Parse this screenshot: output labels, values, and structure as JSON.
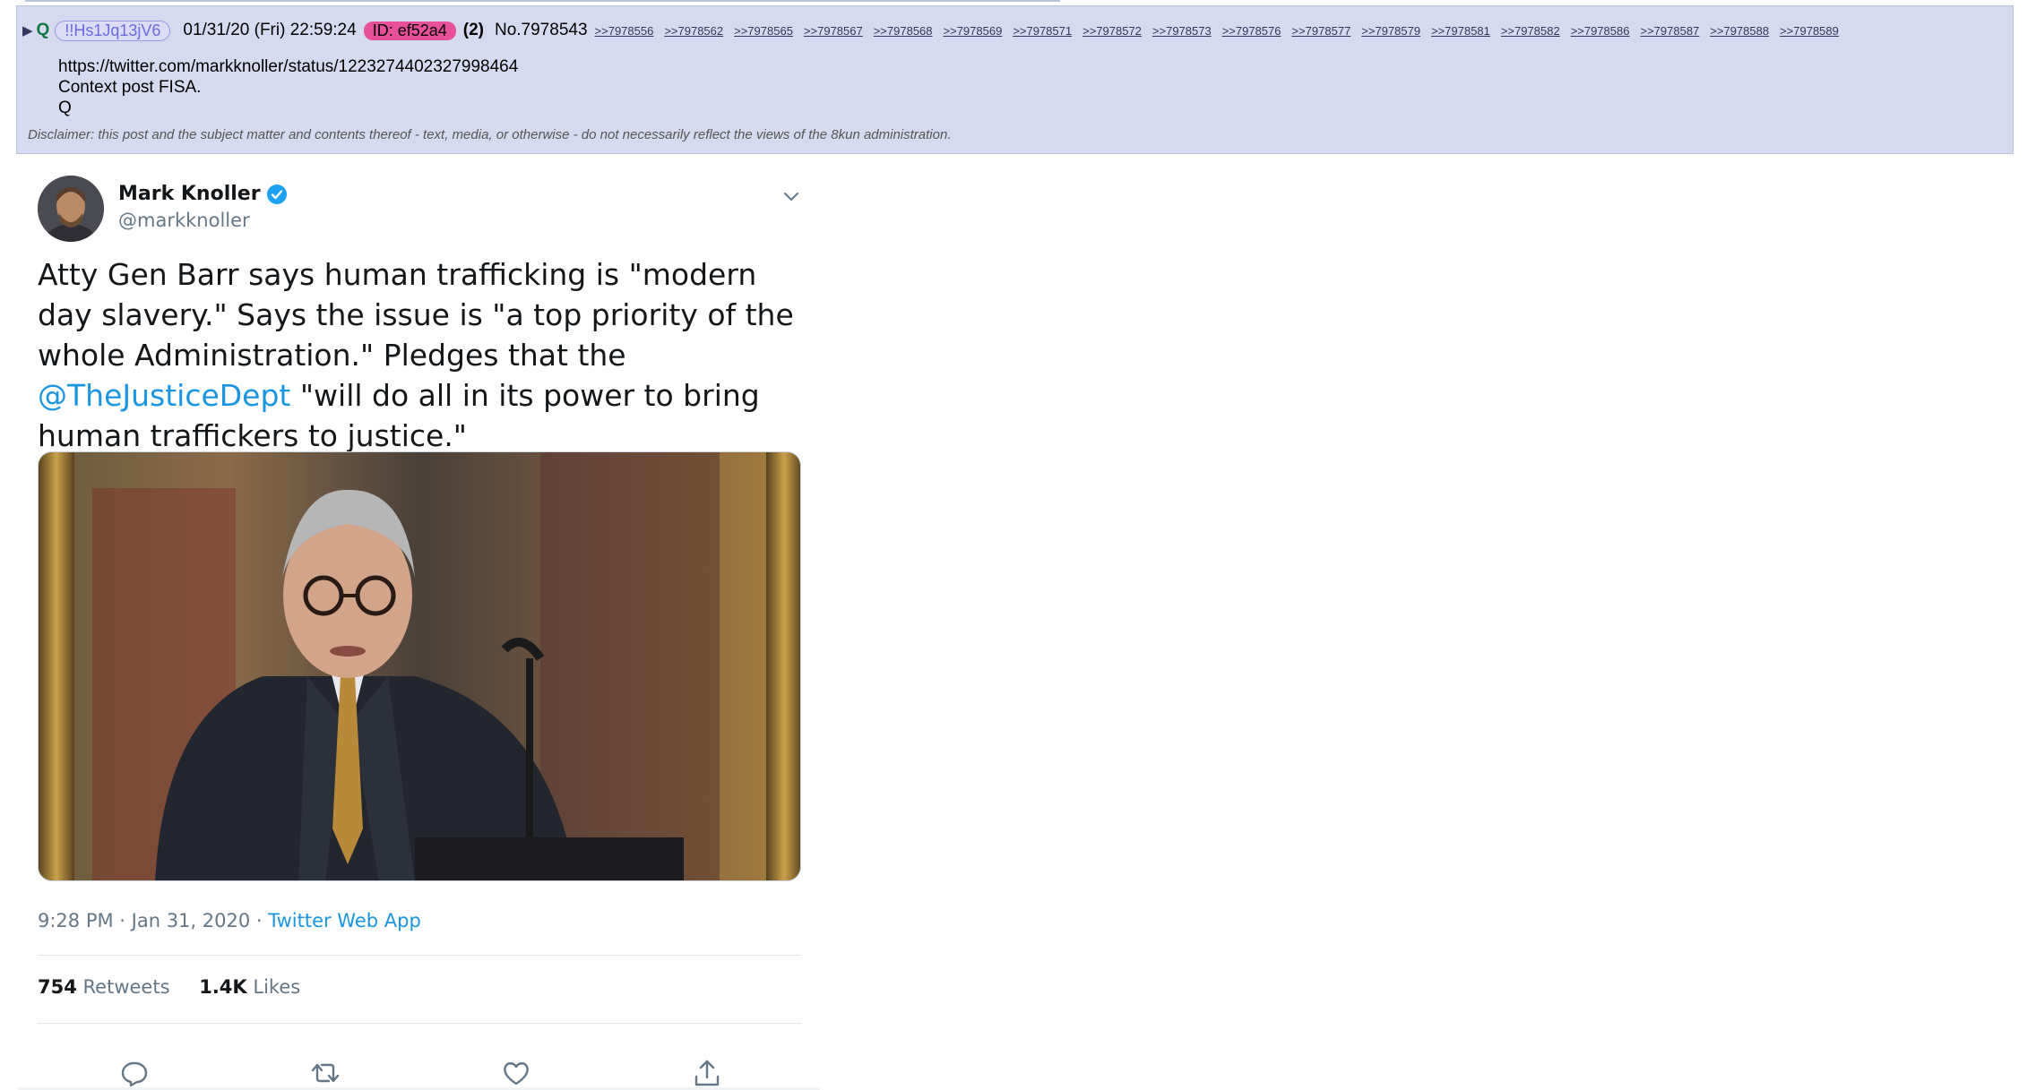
{
  "post": {
    "marker": "▶",
    "name": "Q",
    "tripcode": "!!Hs1Jq13jV6",
    "datetime": "01/31/20 (Fri) 22:59:24",
    "poster_id": "ID: ef52a4",
    "post_count": "(2)",
    "post_number": "No.7978543",
    "backlinks": [
      ">>7978556",
      ">>7978562",
      ">>7978565",
      ">>7978567",
      ">>7978568",
      ">>7978569",
      ">>7978571",
      ">>7978572",
      ">>7978573",
      ">>7978576",
      ">>7978577",
      ">>7978579",
      ">>7978581",
      ">>7978582",
      ">>7978586",
      ">>7978587",
      ">>7978588",
      ">>7978589"
    ],
    "body_lines": [
      "https://twitter.com/markknoller/status/1223274402327998464",
      "Context post FISA.",
      "Q"
    ],
    "disclaimer": "Disclaimer: this post and the subject matter and contents thereof - text, media, or otherwise - do not necessarily reflect the views of the 8kun administration."
  },
  "tweet": {
    "display_name": "Mark Knoller",
    "handle": "@markknoller",
    "text_before": "Atty Gen Barr says human trafficking is \"modern day slavery.\" Says the issue is \"a top priority of the whole Administration.\" Pledges that the ",
    "mention": "@TheJusticeDept",
    "text_after": " \"will do all in its power to bring human traffickers to justice.\"",
    "time": "9:28 PM · Jan 31, 2020 · ",
    "source": "Twitter Web App",
    "retweets_count": "754",
    "retweets_label": "Retweets",
    "likes_count": "1.4K",
    "likes_label": "Likes",
    "icons": [
      "verified-badge-icon",
      "chevron-down-icon",
      "reply-icon",
      "retweet-icon",
      "like-icon",
      "share-icon"
    ]
  },
  "colors": {
    "post_background": "#d6daf0",
    "post_border": "#b7c5d9",
    "name_green": "#117743",
    "poster_id_pink": "#e8509c",
    "twitter_blue": "#1b95e0",
    "muted_gray": "#657786"
  }
}
